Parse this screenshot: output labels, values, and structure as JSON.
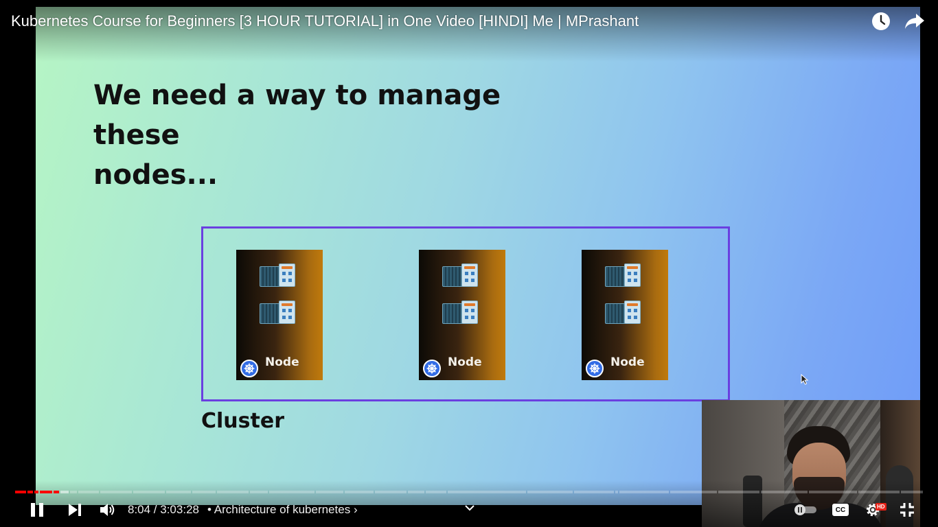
{
  "header": {
    "video_title": "Kubernetes Course for Beginners [3 HOUR TUTORIAL] in One Video [HINDI] Me | MPrashant",
    "watch_later_icon": "clock-icon",
    "share_icon": "share-arrow-icon"
  },
  "slide": {
    "heading_line1": "We need a way to manage these",
    "heading_line2": "nodes...",
    "nodes": [
      {
        "label": "Node"
      },
      {
        "label": "Node"
      },
      {
        "label": "Node"
      }
    ],
    "cluster_label": "Cluster",
    "cluster_border_color": "#6a3fe0"
  },
  "controls": {
    "play_pause_icon": "pause-icon",
    "next_icon": "next-icon",
    "volume_icon": "volume-icon",
    "current_time": "8:04",
    "duration": "3:03:28",
    "time_display": "8:04 / 3:03:28",
    "separator": "•",
    "chapter_title": "Architecture of kubernetes",
    "chapter_chevron": "›",
    "autoplay_icon": "autoplay-toggle-icon",
    "captions_label": "CC",
    "settings_icon": "gear-icon",
    "quality_badge": "HD",
    "fullscreen_icon": "exit-fullscreen-icon",
    "progress_played_color": "#ff0000",
    "progress_fraction": 0.044
  }
}
